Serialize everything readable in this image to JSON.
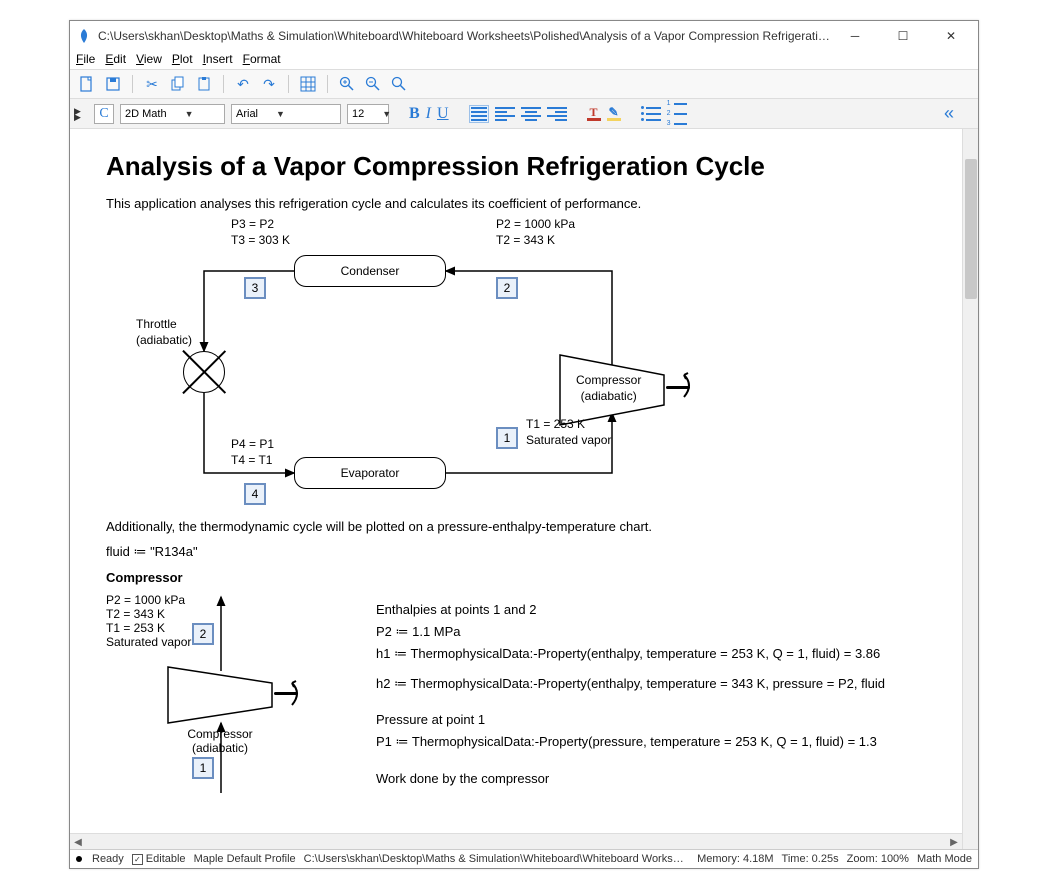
{
  "title": "C:\\Users\\skhan\\Desktop\\Maths & Simulation\\Whiteboard\\Whiteboard Worksheets\\Polished\\Analysis of a Vapor Compression Refrigeration Cycle.w...",
  "menu": [
    "File",
    "Edit",
    "View",
    "Plot",
    "Insert",
    "Format"
  ],
  "format_bar": {
    "mode": "2D Math",
    "font": "Arial",
    "size": "12"
  },
  "doc": {
    "heading": "Analysis of a Vapor Compression Refrigeration Cycle",
    "intro": "This application analyses this refrigeration cycle and calculates its coefficient of performance.",
    "diagram": {
      "state2": {
        "p": "P2 = 1000 kPa",
        "t": "T2 = 343 K"
      },
      "state3": {
        "p": "P3 = P2",
        "t": "T3 = 303 K"
      },
      "state1": {
        "t": "T1 = 253 K",
        "q": "Saturated vapor"
      },
      "state4": {
        "p": "P4 = P1",
        "t": "T4 = T1"
      },
      "condenser": "Condenser",
      "evaporator": "Evaporator",
      "compressor": {
        "l1": "Compressor",
        "l2": "(adiabatic)"
      },
      "throttle": {
        "l1": "Throttle",
        "l2": "(adiabatic)"
      },
      "n1": "1",
      "n2": "2",
      "n3": "3",
      "n4": "4"
    },
    "additional": "Additionally, the thermodynamic cycle will be plotted on a pressure-enthalpy-temperature chart.",
    "fluid_line": "fluid ≔ \"R134a\"",
    "compressor_section": "Compressor",
    "diag2": {
      "state2": {
        "p": "P2 = 1000 kPa",
        "t": "T2 = 343 K"
      },
      "state1": {
        "t": "T1 = 253 K",
        "q": "Saturated vapor"
      },
      "compressor": {
        "l1": "Compressor",
        "l2": "(adiabatic)"
      },
      "n1": "1",
      "n2": "2"
    },
    "calc": {
      "enth_head": "Enthalpies at points 1 and 2",
      "p2": "P2 ≔ 1.1 MPa",
      "h1": "h1 ≔ ThermophysicalData:-Property(enthalpy, temperature = 253 K, Q = 1, fluid) = 3.86",
      "h2": "h2 ≔ ThermophysicalData:-Property(enthalpy, temperature = 343 K, pressure = P2, fluid",
      "press_head": "Pressure at point 1",
      "p1": "P1 ≔ ThermophysicalData:-Property(pressure, temperature = 253 K, Q = 1, fluid) = 1.3",
      "work_head": "Work done by the compressor"
    }
  },
  "status": {
    "ready": "Ready",
    "editable": "Editable",
    "profile": "Maple Default Profile",
    "path": "C:\\Users\\skhan\\Desktop\\Maths & Simulation\\Whiteboard\\Whiteboard Worksheets\\Polished",
    "memory": "Memory: 4.18M",
    "time": "Time: 0.25s",
    "zoom": "Zoom: 100%",
    "mode": "Math Mode"
  }
}
